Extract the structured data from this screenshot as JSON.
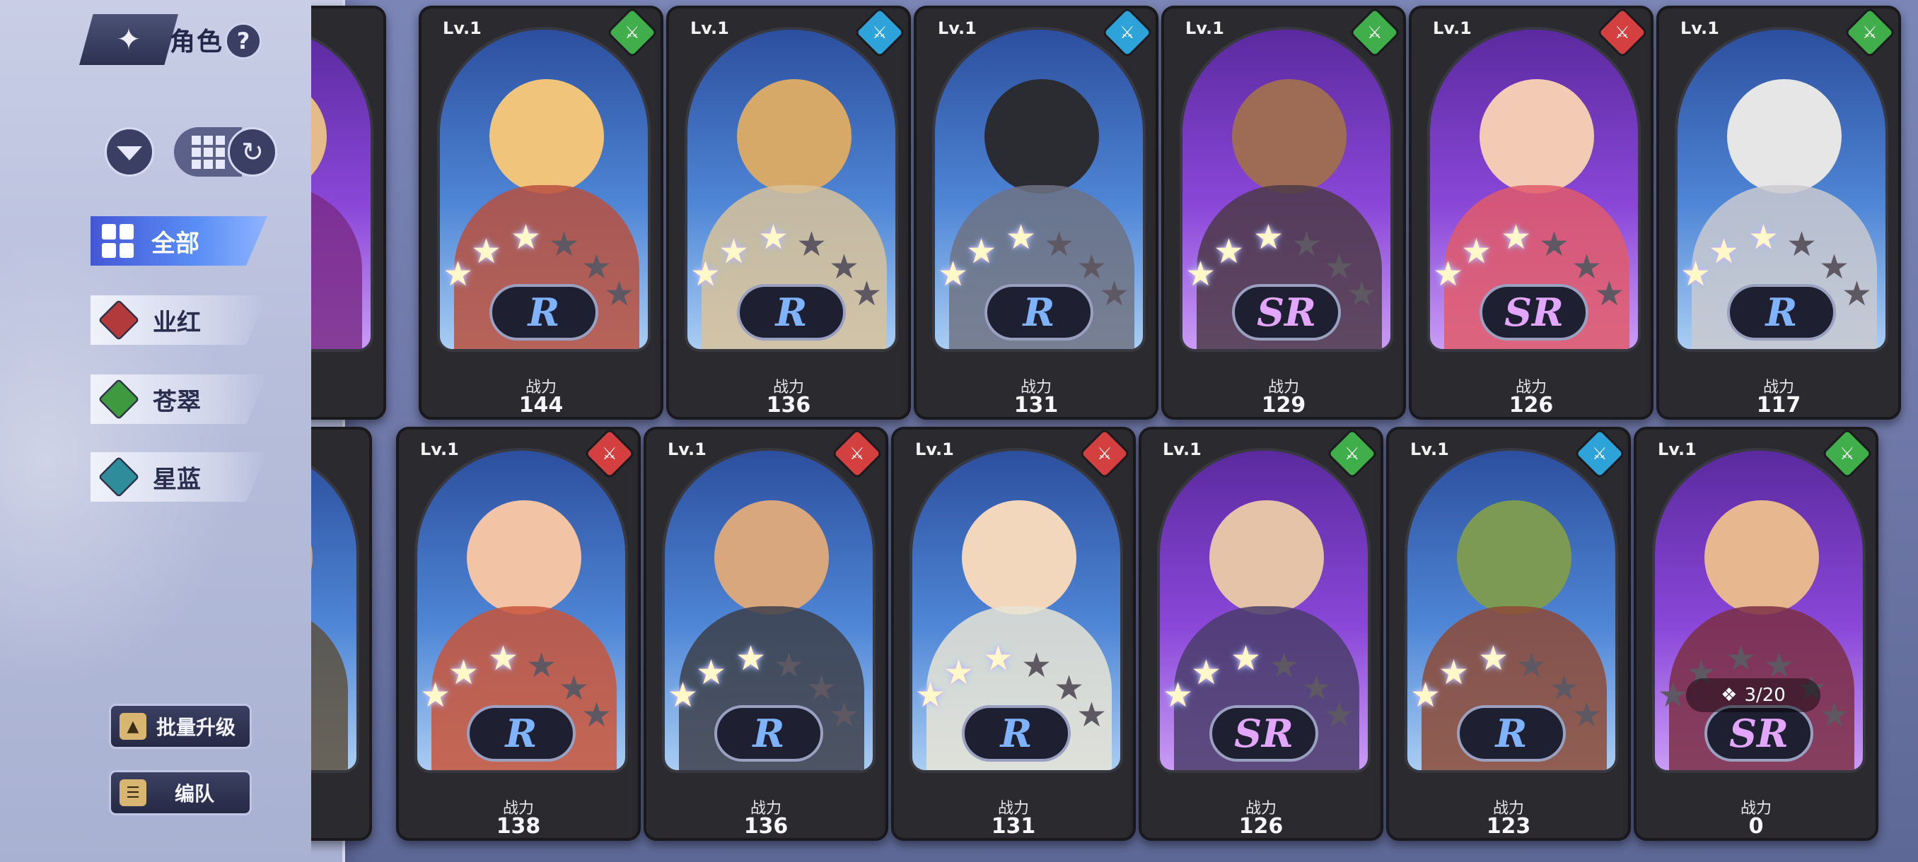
{
  "header": {
    "title": "角色",
    "help_label": "?"
  },
  "toolbar": {
    "filter_icon": "filter-icon",
    "grid_icon": "grid-icon",
    "swap_icon": "refresh-icon"
  },
  "categories": [
    {
      "label": "全部",
      "active": true,
      "color": "#4457d6"
    },
    {
      "label": "业红",
      "active": false,
      "color": "#b23a3a"
    },
    {
      "label": "苍翠",
      "active": false,
      "color": "#3f9a3f"
    },
    {
      "label": "星蓝",
      "active": false,
      "color": "#2f8c9a"
    }
  ],
  "buttons": {
    "batch_upgrade": "批量升级",
    "formation": "编队"
  },
  "power_label": "战力",
  "cards_row1": [
    {
      "level": "Lv.1",
      "rarity": "R",
      "power": "144",
      "element_color": "#3fae4b",
      "stars_lit": 3,
      "skin": "#f0c47a",
      "body": "#b8503e"
    },
    {
      "level": "Lv.1",
      "rarity": "R",
      "power": "136",
      "element_color": "#2ea3d9",
      "stars_lit": 3,
      "skin": "#d7a968",
      "body": "#d8c29a"
    },
    {
      "level": "Lv.1",
      "rarity": "R",
      "power": "131",
      "element_color": "#2ea3d9",
      "stars_lit": 3,
      "skin": "#2b2b32",
      "body": "#6f7282"
    },
    {
      "level": "Lv.1",
      "rarity": "SR",
      "power": "129",
      "element_color": "#3fae4b",
      "stars_lit": 3,
      "skin": "#9e6b55",
      "body": "#4c3a48"
    },
    {
      "level": "Lv.1",
      "rarity": "SR",
      "power": "126",
      "element_color": "#d44040",
      "stars_lit": 3,
      "skin": "#f3cbb4",
      "body": "#e05b6a"
    },
    {
      "level": "Lv.1",
      "rarity": "R",
      "power": "117",
      "element_color": "#3fae4b",
      "stars_lit": 3,
      "skin": "#e6e6e6",
      "body": "#c9c9cf"
    }
  ],
  "cards_row2": [
    {
      "level": "Lv.1",
      "rarity": "R",
      "power": "138",
      "element_color": "#d44040",
      "stars_lit": 3,
      "skin": "#f2c3a5",
      "body": "#c9553a",
      "fragments": ""
    },
    {
      "level": "Lv.1",
      "rarity": "R",
      "power": "136",
      "element_color": "#d44040",
      "stars_lit": 3,
      "skin": "#d9a77e",
      "body": "#3d3f4a",
      "fragments": ""
    },
    {
      "level": "Lv.1",
      "rarity": "R",
      "power": "131",
      "element_color": "#d44040",
      "stars_lit": 3,
      "skin": "#f2d7bd",
      "body": "#e8e4d5",
      "fragments": ""
    },
    {
      "level": "Lv.1",
      "rarity": "SR",
      "power": "126",
      "element_color": "#3fae4b",
      "stars_lit": 3,
      "skin": "#e5c3a8",
      "body": "#4a3d6b",
      "fragments": ""
    },
    {
      "level": "Lv.1",
      "rarity": "R",
      "power": "123",
      "element_color": "#2ea3d9",
      "stars_lit": 3,
      "skin": "#7d9a55",
      "body": "#8d4a36",
      "fragments": ""
    },
    {
      "level": "Lv.1",
      "rarity": "SR",
      "power": "0",
      "element_color": "#3fae4b",
      "stars_lit": 0,
      "skin": "#e7b88f",
      "body": "#7b2f44",
      "fragments": "3/20"
    }
  ]
}
